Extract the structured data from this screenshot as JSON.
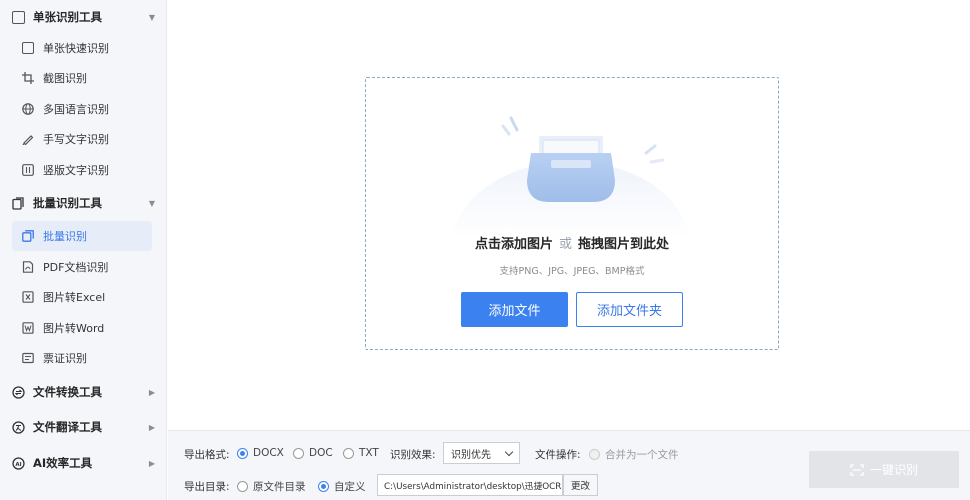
{
  "sidebar": {
    "groups": [
      {
        "label": "单张识别工具",
        "items": [
          {
            "label": "单张快速识别"
          },
          {
            "label": "截图识别"
          },
          {
            "label": "多国语言识别"
          },
          {
            "label": "手写文字识别"
          },
          {
            "label": "竖版文字识别"
          }
        ]
      },
      {
        "label": "批量识别工具",
        "items": [
          {
            "label": "批量识别"
          },
          {
            "label": "PDF文档识别"
          },
          {
            "label": "图片转Excel"
          },
          {
            "label": "图片转Word"
          },
          {
            "label": "票证识别"
          }
        ]
      },
      {
        "label": "文件转换工具"
      },
      {
        "label": "文件翻译工具"
      },
      {
        "label": "AI效率工具"
      }
    ]
  },
  "upload": {
    "title_part1": "点击添加图片",
    "title_or": "或",
    "title_part2": "拖拽图片到此处",
    "subtitle": "支持PNG、JPG、JPEG、BMP格式",
    "add_file_label": "添加文件",
    "add_folder_label": "添加文件夹"
  },
  "bottom": {
    "format_label": "导出格式:",
    "formats": [
      "DOCX",
      "DOC",
      "TXT"
    ],
    "selected_format": "DOCX",
    "effect_label": "识别效果:",
    "effect_value": "识别优先",
    "file_op_label": "文件操作:",
    "merge_label": "合并为一个文件",
    "dir_label": "导出目录:",
    "dir_options": [
      "原文件目录",
      "自定义"
    ],
    "selected_dir": "自定义",
    "path_value": "C:\\Users\\Administrator\\desktop\\迅捷OCR文",
    "change_label": "更改",
    "run_label": "一键识别"
  },
  "colors": {
    "accent": "#3b82f0",
    "sidebar_bg": "#f4f6fa",
    "active_bg": "#e6edf8",
    "dropzone_border": "#88a9c9",
    "disabled_button": "#e2e4e8"
  }
}
